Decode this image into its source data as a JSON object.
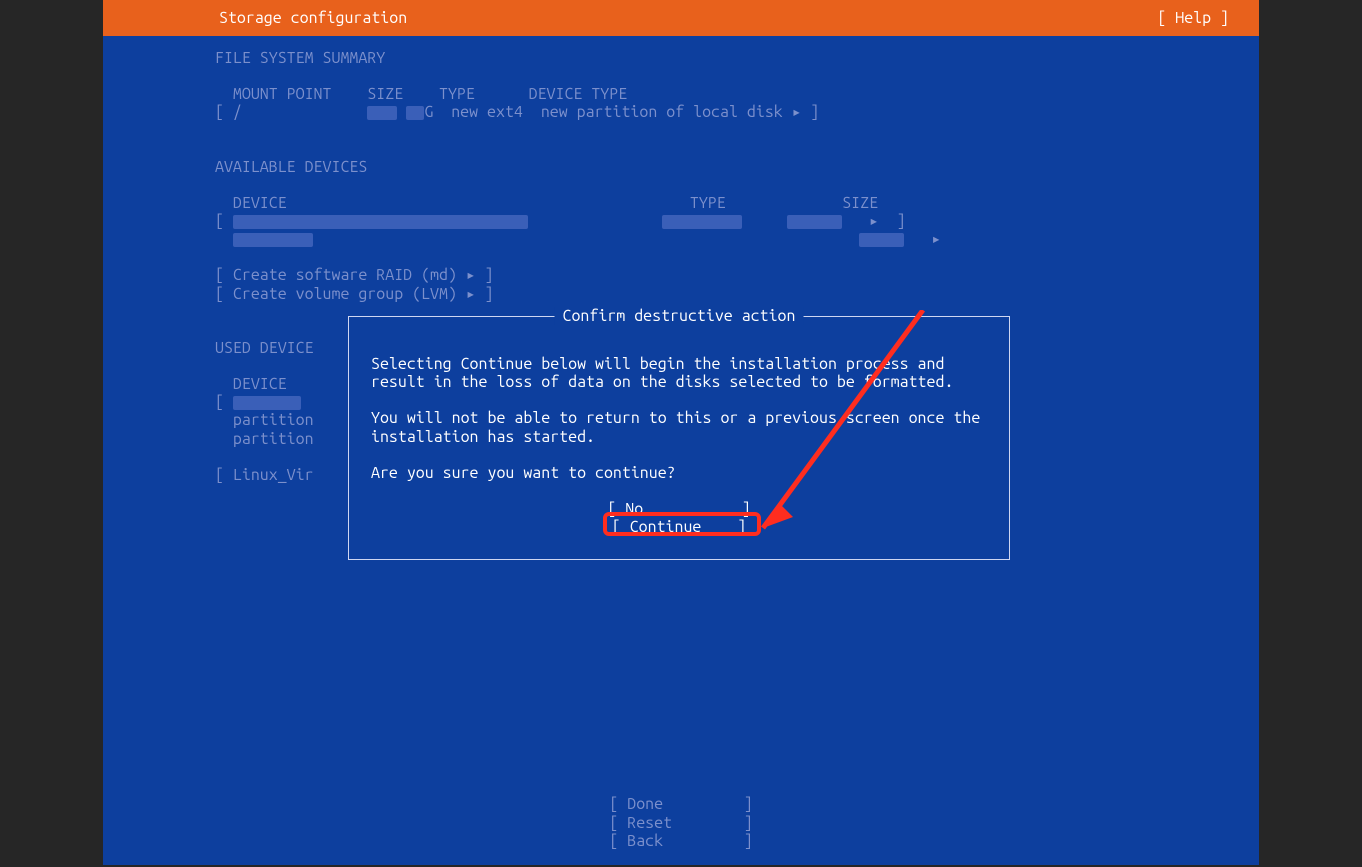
{
  "header": {
    "title": "Storage configuration",
    "help_label": "[ Help ]"
  },
  "sections": {
    "file_system_summary": {
      "title": "FILE SYSTEM SUMMARY",
      "columns": {
        "mount": "MOUNT POINT",
        "size": "SIZE",
        "type": "TYPE",
        "device_type": "DEVICE TYPE"
      },
      "row": {
        "open": "[ ",
        "mount": "/",
        "size_suffix": "G",
        "type": "new ext4",
        "device_type": "new partition of local disk",
        "arrow": "▸",
        "close": " ]"
      }
    },
    "available_devices": {
      "title": "AVAILABLE DEVICES",
      "columns": {
        "device": "DEVICE",
        "type": "TYPE",
        "size": "SIZE"
      },
      "create_raid": "[ Create software RAID (md) ▸ ]",
      "create_lvm": "[ Create volume group (LVM) ▸ ]"
    },
    "used_device": {
      "title": "USED DEVICE",
      "columns": {
        "device": "DEVICE"
      },
      "rows": {
        "open": "[",
        "part1": "partition",
        "part2": "partition",
        "linux_vir": "[ Linux_Vir"
      }
    }
  },
  "footer": {
    "done": "[ Done         ]",
    "reset": "[ Reset        ]",
    "back": "[ Back         ]"
  },
  "dialog": {
    "title": "Confirm destructive action",
    "para1": "Selecting Continue below will begin the installation process and result in the loss of data on the disks selected to be formatted.",
    "para2": "You will not be able to return to this or a previous screen once the installation has started.",
    "para3": "Are you sure you want to continue?",
    "btn_no": "[ No           ]",
    "btn_continue_open": "[ ",
    "btn_continue_letter": "C",
    "btn_continue_rest": "ontinue    ]"
  }
}
